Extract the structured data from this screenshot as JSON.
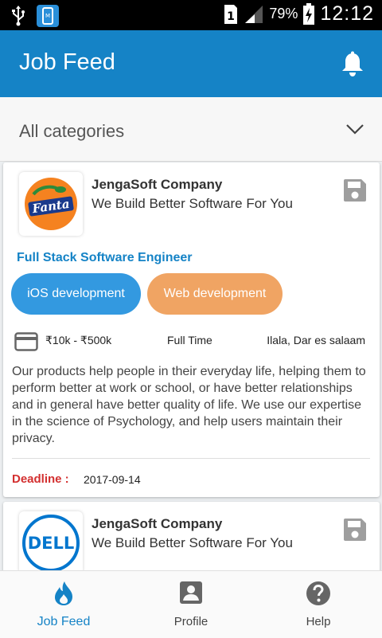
{
  "status_bar": {
    "battery": "79%",
    "time": "12:12",
    "icons": [
      "usb-icon",
      "notification-icon",
      "sim-icon",
      "signal-icon",
      "battery-charging-icon"
    ]
  },
  "app_bar": {
    "title": "Job Feed",
    "bell_icon": "bell-icon"
  },
  "category_filter": {
    "selected": "All categories",
    "icon": "chevron-down-icon"
  },
  "jobs": [
    {
      "company": "JengaSoft Company",
      "slogan": "We Build Better Software For You",
      "logo_text": "Fanta",
      "title": "Full Stack Software Engineer",
      "tags": [
        "iOS development",
        "Web development"
      ],
      "salary": "₹10k - ₹500k",
      "type": "Full Time",
      "location": "Ilala, Dar es salaam",
      "description": "Our products help people in their everyday life, helping them to perform better at work or school, or have better relationships and in general have better quality of life. We use our expertise in the science of Psychology, and help users maintain their privacy.",
      "deadline_label": "Deadline :",
      "deadline": "2017-09-14"
    },
    {
      "company": "JengaSoft Company",
      "slogan": "We Build Better Software For You",
      "logo_text": "DELL"
    }
  ],
  "bottom_nav": [
    {
      "label": "Job Feed",
      "icon": "flame-icon",
      "active": true
    },
    {
      "label": "Profile",
      "icon": "profile-icon",
      "active": false
    },
    {
      "label": "Help",
      "icon": "help-icon",
      "active": false
    }
  ],
  "colors": {
    "primary": "#1583c6",
    "tag_blue": "#3399e0",
    "tag_orange": "#f0a463",
    "deadline_red": "#d32f2f"
  }
}
